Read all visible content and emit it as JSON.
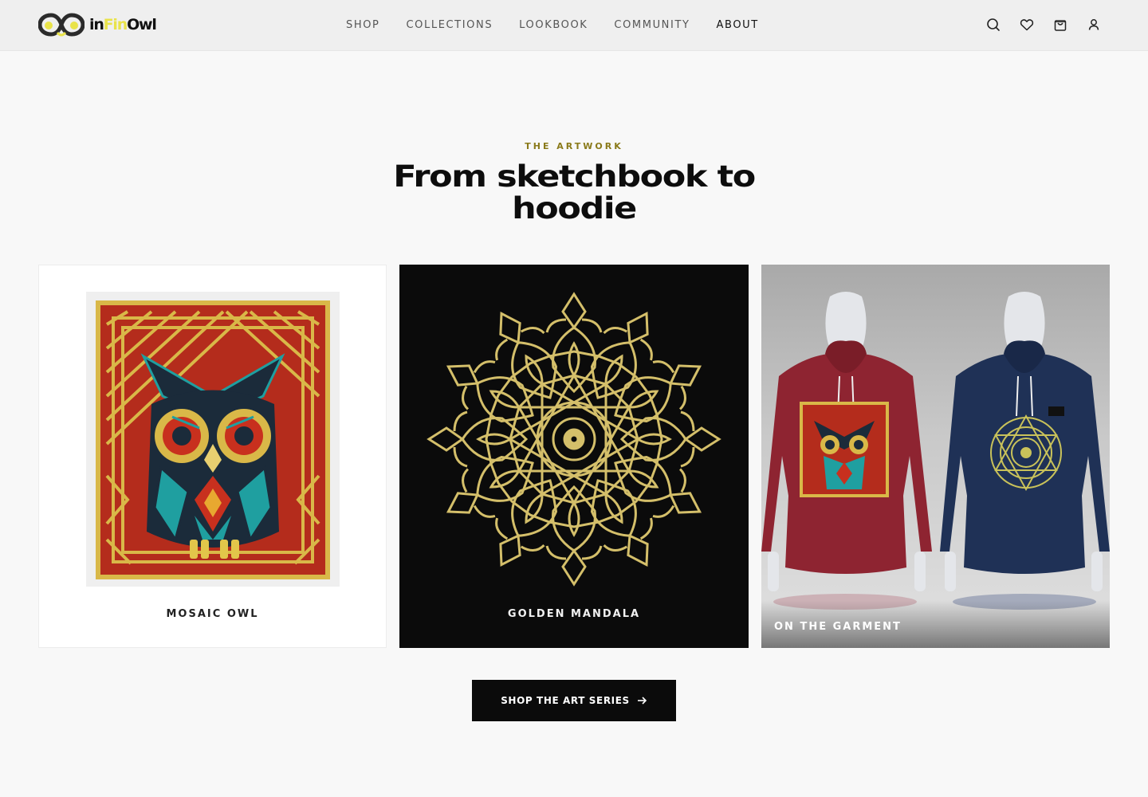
{
  "brand": {
    "name_pre": "in",
    "name_mid": "Fin",
    "name_post": "Owl",
    "accent": "#e9e34a"
  },
  "nav": {
    "items": [
      "SHOP",
      "COLLECTIONS",
      "LOOKBOOK",
      "COMMUNITY",
      "ABOUT"
    ],
    "active": "ABOUT"
  },
  "header_icons": [
    "search-icon",
    "heart-icon",
    "bag-icon",
    "user-icon"
  ],
  "section": {
    "eyebrow": "THE ARTWORK",
    "title_line1": "From sketchbook to",
    "title_line2": "hoodie"
  },
  "cards": [
    {
      "caption": "MOSAIC OWL"
    },
    {
      "caption": "GOLDEN MANDALA"
    },
    {
      "caption": "ON THE GARMENT"
    }
  ],
  "cta": {
    "label": "SHOP THE ART SERIES"
  },
  "colors": {
    "gold": "#d4bf6a",
    "owl_red": "#b42c1c",
    "owl_teal": "#1f9fa0",
    "owl_navy": "#1b2b3a",
    "hoodie_red": "#8e2431",
    "hoodie_navy": "#1f3156"
  }
}
